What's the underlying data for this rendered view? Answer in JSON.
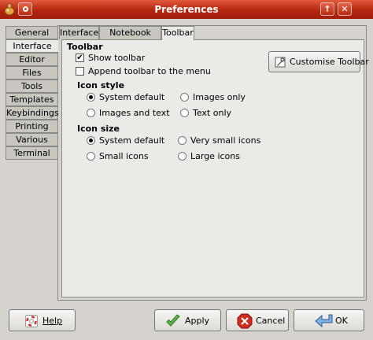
{
  "window": {
    "title": "Preferences",
    "up_glyph": "↑",
    "close_glyph": "✕"
  },
  "sidebar": {
    "tabs": [
      {
        "label": "General"
      },
      {
        "label": "Interface",
        "active": true
      },
      {
        "label": "Editor"
      },
      {
        "label": "Files"
      },
      {
        "label": "Tools"
      },
      {
        "label": "Templates"
      },
      {
        "label": "Keybindings"
      },
      {
        "label": "Printing"
      },
      {
        "label": "Various"
      },
      {
        "label": "Terminal"
      }
    ]
  },
  "subtabs": [
    {
      "label": "Interface"
    },
    {
      "label": "Notebook tabs"
    },
    {
      "label": "Toolbar",
      "active": true
    }
  ],
  "toolbar_section": {
    "heading": "Toolbar",
    "show_toolbar": {
      "label": "Show toolbar",
      "checked": true
    },
    "append_toolbar": {
      "label": "Append toolbar to the menu",
      "checked": false
    },
    "customise_button": "Customise Toolbar",
    "check_glyph": "✔"
  },
  "icon_style": {
    "heading": "Icon style",
    "options": [
      {
        "label": "System default",
        "selected": true
      },
      {
        "label": "Images only",
        "selected": false
      },
      {
        "label": "Images and text",
        "selected": false
      },
      {
        "label": "Text only",
        "selected": false
      }
    ]
  },
  "icon_size": {
    "heading": "Icon size",
    "options": [
      {
        "label": "System default",
        "selected": true
      },
      {
        "label": "Very small icons",
        "selected": false
      },
      {
        "label": "Small icons",
        "selected": false
      },
      {
        "label": "Large icons",
        "selected": false
      }
    ]
  },
  "buttons": {
    "help": "Help",
    "apply": "Apply",
    "cancel": "Cancel",
    "ok": "OK"
  },
  "colors": {
    "titlebar": "#b3260f",
    "panel_bg": "#ebeae7",
    "window_bg": "#d6d3ce"
  }
}
